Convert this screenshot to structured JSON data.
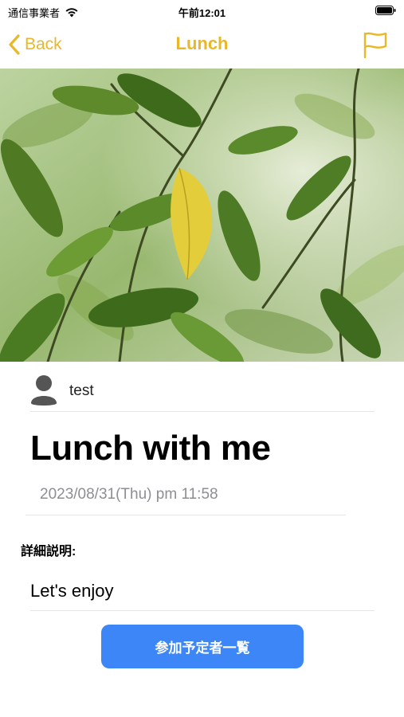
{
  "status_bar": {
    "carrier": "通信事業者",
    "time": "午前12:01",
    "icons": [
      "wifi-icon",
      "battery-icon"
    ]
  },
  "nav": {
    "back_label": "Back",
    "title": "Lunch",
    "right_icon": "flag-icon"
  },
  "event": {
    "author": "test",
    "title": "Lunch with me",
    "date": "2023/08/31(Thu) pm 11:58",
    "details_label": "詳細説明:",
    "details_text": "Let's enjoy"
  },
  "actions": {
    "participants_button_label": "参加予定者一覧"
  },
  "colors": {
    "accent": "#e8b82a",
    "button_blue": "#3d86f7",
    "secondary_text": "#8e8e93"
  }
}
